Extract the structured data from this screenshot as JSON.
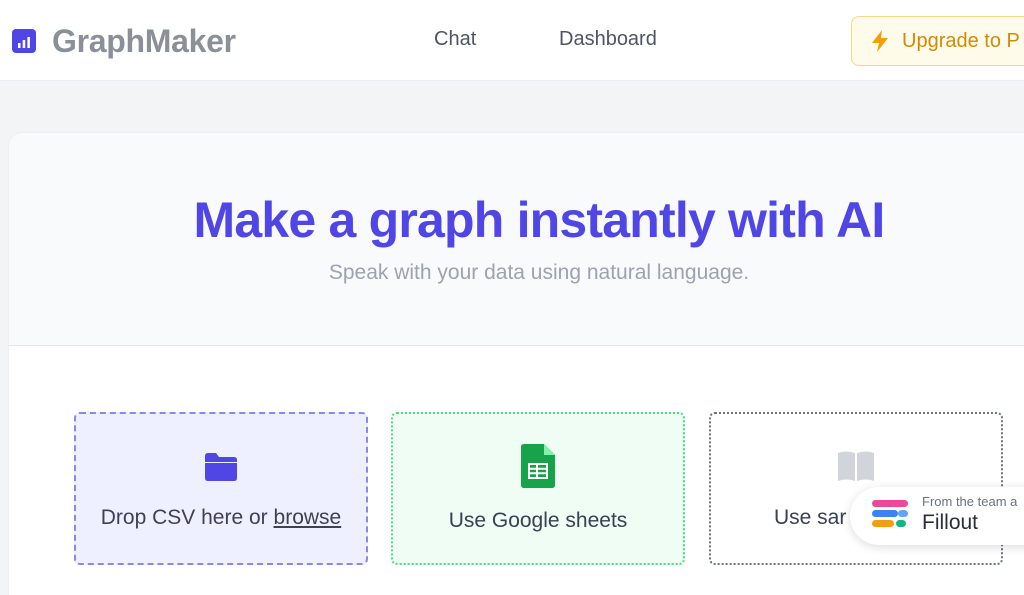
{
  "header": {
    "brand": "GraphMaker",
    "nav": [
      {
        "label": "Chat"
      },
      {
        "label": "Dashboard"
      }
    ],
    "upgrade_label": "Upgrade to P"
  },
  "hero": {
    "title": "Make a graph instantly with AI",
    "subtitle": "Speak with your data using natural language."
  },
  "options": {
    "csv": {
      "text": "Drop CSV here or ",
      "link": "browse",
      "icon": "folder-icon"
    },
    "sheets": {
      "label": "Use Google sheets",
      "icon": "google-sheets-icon"
    },
    "sample": {
      "label": "Use sar",
      "icon": "book-icon"
    }
  },
  "fillout": {
    "team": "From the team a",
    "name": "Fillout"
  },
  "colors": {
    "accent": "#4f46e5",
    "upgrade_text": "#d08a06",
    "sheets_green": "#16a34a"
  }
}
